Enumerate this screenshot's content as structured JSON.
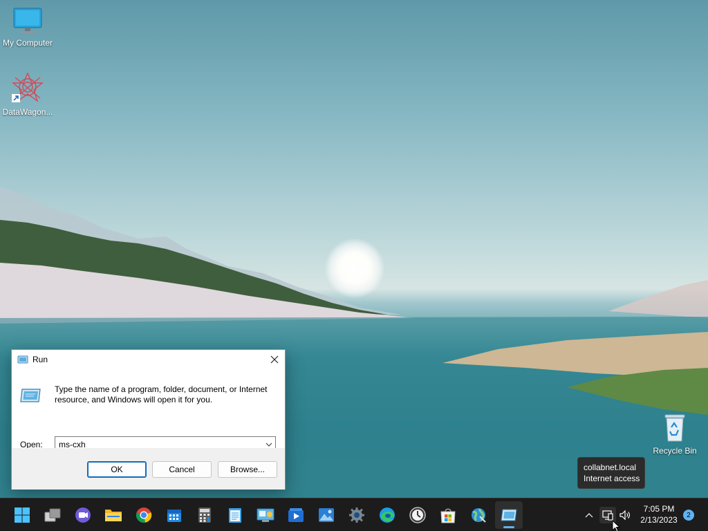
{
  "desktop": {
    "icons": [
      {
        "label": "My Computer",
        "icon": "computer-monitor-icon"
      },
      {
        "label": "DataWagon...",
        "icon": "datawagon-icon"
      },
      {
        "label": "Recycle Bin",
        "icon": "recycle-bin-icon"
      }
    ]
  },
  "run_dialog": {
    "title": "Run",
    "description": "Type the name of a program, folder, document, or Internet resource, and Windows will open it for you.",
    "open_label": "Open:",
    "open_value": "ms-cxh",
    "ok_label": "OK",
    "cancel_label": "Cancel",
    "browse_label": "Browse..."
  },
  "tooltip": {
    "line1": "collabnet.local",
    "line2": "Internet access"
  },
  "taskbar": {
    "apps": [
      {
        "name": "start",
        "icon": "windows-start-icon"
      },
      {
        "name": "task-view",
        "icon": "task-view-icon"
      },
      {
        "name": "chat",
        "icon": "teams-chat-icon"
      },
      {
        "name": "file-explorer",
        "icon": "folder-icon"
      },
      {
        "name": "chrome",
        "icon": "chrome-icon"
      },
      {
        "name": "calendar",
        "icon": "calendar-icon"
      },
      {
        "name": "calculator",
        "icon": "calculator-icon"
      },
      {
        "name": "notepad",
        "icon": "notepad-icon"
      },
      {
        "name": "control-panel",
        "icon": "control-panel-icon"
      },
      {
        "name": "media-player",
        "icon": "media-player-icon"
      },
      {
        "name": "photos",
        "icon": "photos-icon"
      },
      {
        "name": "settings",
        "icon": "settings-gear-icon"
      },
      {
        "name": "edge",
        "icon": "edge-icon"
      },
      {
        "name": "clock",
        "icon": "clock-icon"
      },
      {
        "name": "store",
        "icon": "store-icon"
      },
      {
        "name": "network-app",
        "icon": "globe-network-icon"
      },
      {
        "name": "run",
        "icon": "run-icon",
        "active": true
      }
    ],
    "clock_time": "7:05 PM",
    "clock_date": "2/13/2023",
    "notification_count": "2"
  },
  "colors": {
    "taskbar_bg": "#1c1c1c",
    "accent": "#0f6cbd",
    "indicator": "#5fb2f2"
  }
}
